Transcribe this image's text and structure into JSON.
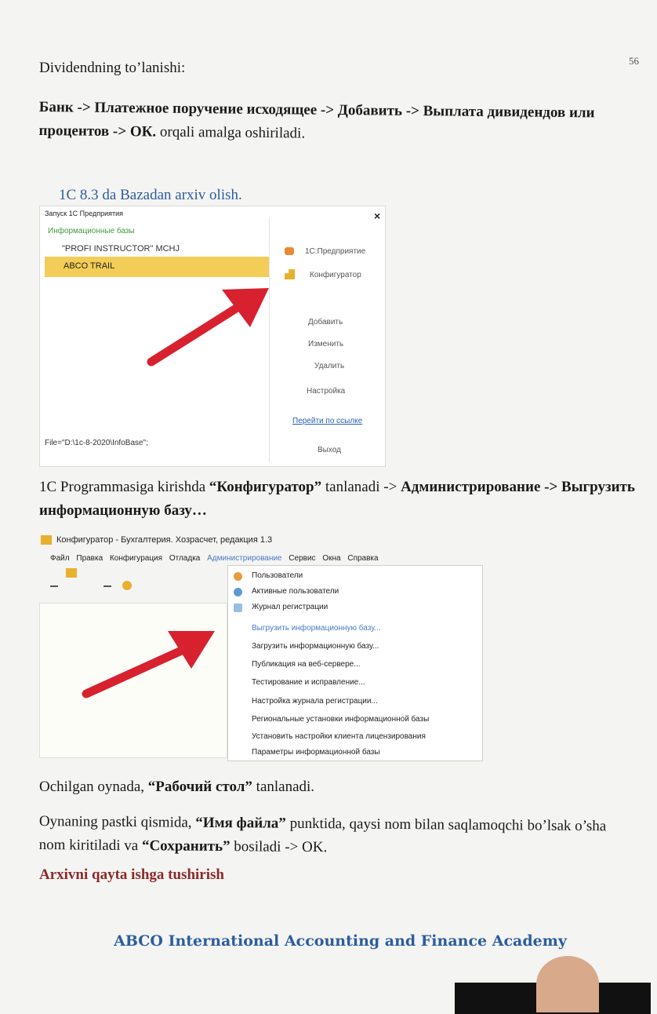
{
  "page_number": "56",
  "para1": "Dividendning to’lanishi:",
  "para2": {
    "bold": "Банк -> Платежное поручение исходящее -> Добавить -> Выплата дивидендов или процентов -> ОК.",
    "rest": " orqali amalga oshiriladi."
  },
  "section_heading": "1C 8.3 da Bazadan arxiv olish.",
  "launcher": {
    "title": "Запуск 1С Предприятия",
    "close": "×",
    "group_label": "Информационные базы",
    "items": [
      "\"PROFI INSTRUCTOR\" MCHJ",
      "ABCO TRAIL"
    ],
    "path": "File=\"D:\\1c-8-2020\\InfoBase\";",
    "buttons": {
      "enterprise": "1С:Предприятие",
      "configurator": "Конфигуратор",
      "add": "Добавить",
      "edit": "Изменить",
      "delete": "Удалить",
      "settings": "Настройка",
      "link": "Перейти по ссылке",
      "exit": "Выход"
    }
  },
  "para3": {
    "pre": "1C Programmasiga kirishda ",
    "bold1": "“Конфигуратор”",
    "mid": " tanlanadi -> ",
    "bold2": "Администрирование -> Выгрузить информационную базу…"
  },
  "configurator": {
    "title": "Конфигуратор - Бухгалтерия. Хозрасчет, редакция 1.3",
    "menu": [
      "Файл",
      "Правка",
      "Конфигурация",
      "Отладка",
      "Администрирование",
      "Сервис",
      "Окна",
      "Справка"
    ],
    "dropdown": [
      "Пользователи",
      "Активные пользователи",
      "Журнал регистрации",
      "Выгрузить информационную базу...",
      "Загрузить информационную базу...",
      "Публикация на веб-сервере...",
      "Тестирование и исправление...",
      "Настройка журнала регистрации...",
      "Региональные установки информационной базы",
      "Установить настройки клиента лицензирования",
      "Параметры информационной базы"
    ]
  },
  "para4": {
    "pre": "Ochilgan oynada, ",
    "bold": "“Рабочий стол”",
    "post": " tanlanadi."
  },
  "para5": {
    "pre": "Oynaning pastki qismida, ",
    "bold1": "“Имя файла”",
    "mid": " punktida, qaysi nom bilan saqlamoqchi bo’lsak o’sha nom kiritiladi va ",
    "bold2": "“Сохранить”",
    "post": " bosiladi -> OK."
  },
  "para6": "Arxivni qayta ishga tushirish",
  "footer": "ABCO International Accounting and Finance Academy",
  "colors": {
    "accent_blue": "#2c5d9e",
    "highlight": "#f3cd57",
    "arrow_red": "#d8212f",
    "dark_red": "#8a2a2a"
  }
}
